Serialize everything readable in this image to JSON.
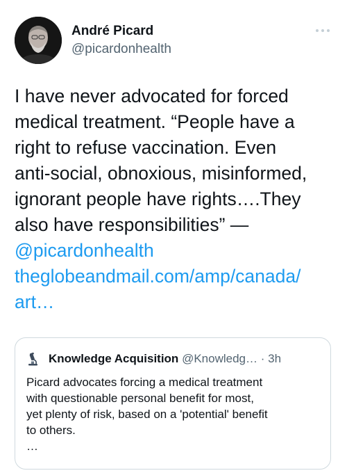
{
  "author": {
    "name": "André Picard",
    "handle": "@picardonhealth"
  },
  "tweet": {
    "lines": [
      "I have never advocated for forced",
      "medical treatment. “People have a",
      "right to refuse vaccination. Even",
      "anti-social, obnoxious, misinformed,",
      "ignorant people have rights….They",
      "also have responsibilities” —"
    ],
    "mention": "@picardonhealth",
    "link_lines": [
      "theglobeandmail.com/amp/canada/",
      "art…"
    ]
  },
  "quoted_tweet": {
    "name": "Knowledge Acquisition",
    "handle": "@Knowledg…",
    "separator": "·",
    "time": "3h",
    "lines": [
      "Picard advocates forcing a medical treatment",
      "with questionable personal benefit for most,",
      "yet plenty of risk, based on a 'potential' benefit",
      "to others.",
      "…"
    ]
  },
  "colors": {
    "link": "#1d9bf0",
    "secondary_text": "#536471",
    "border": "#cfd9de"
  },
  "icons": {
    "more": "more-horizontal-icon",
    "quote_avatar": "microscope-icon"
  }
}
